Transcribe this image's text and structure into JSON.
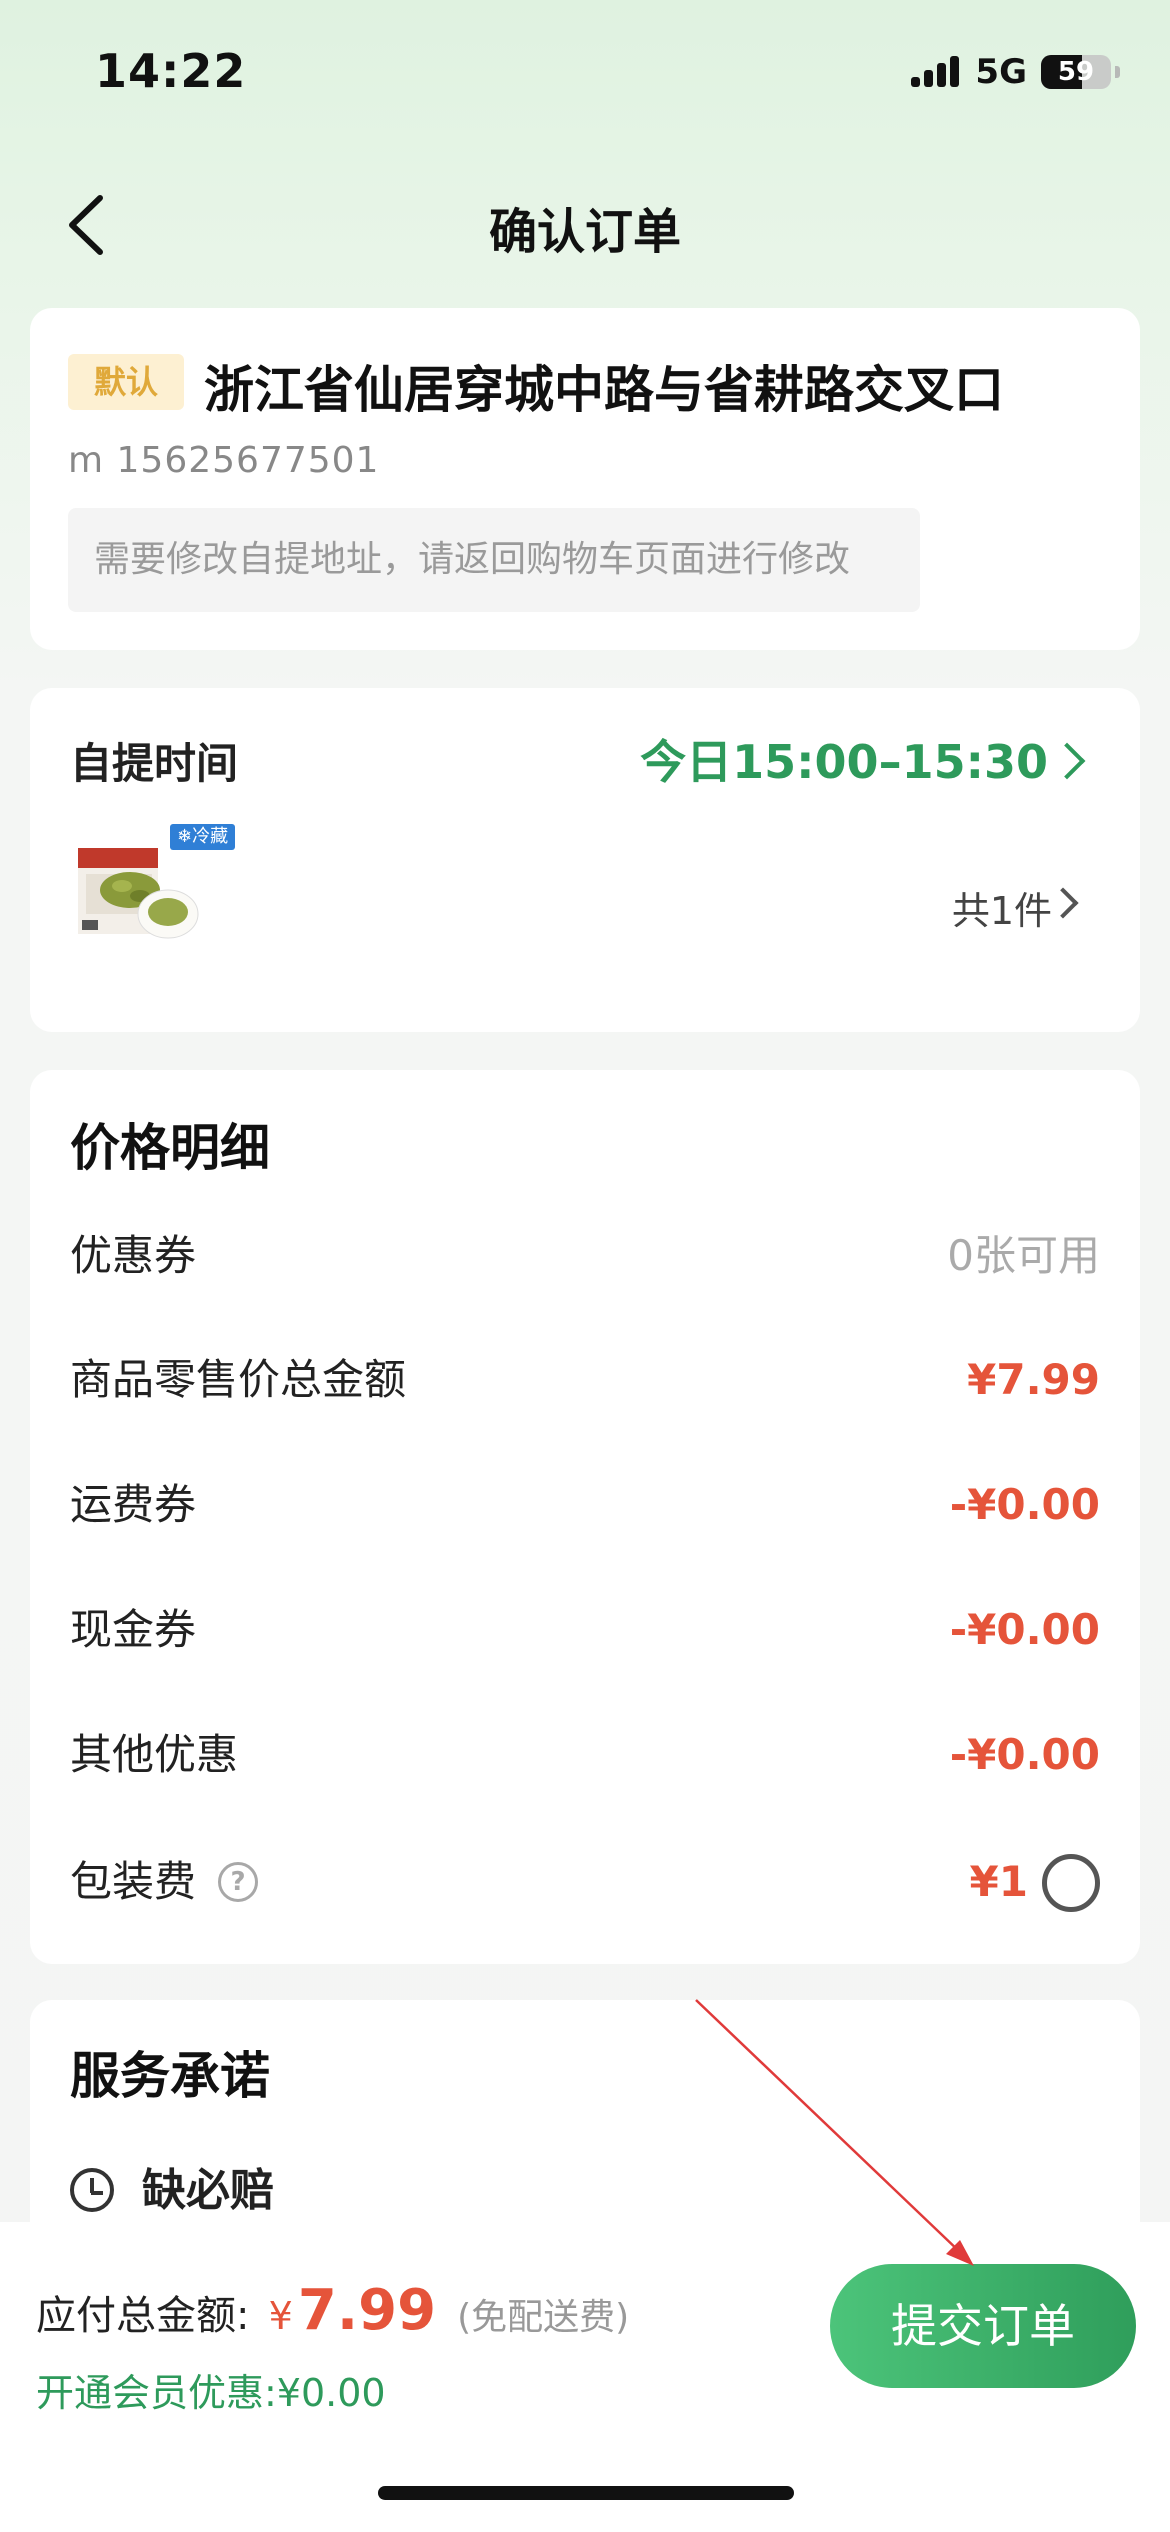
{
  "status_bar": {
    "time": "14:22",
    "network": "5G",
    "battery": "59"
  },
  "nav": {
    "title": "确认订单"
  },
  "address": {
    "badge": "默认",
    "text": "浙江省仙居穿城中路与省耕路交叉口",
    "phone": "m 15625677501",
    "note": "需要修改自提地址，请返回购物车页面进行修改"
  },
  "pickup": {
    "label": "自提时间",
    "time": "今日15:00–15:30",
    "product_tag": "冷藏",
    "count": "共1件"
  },
  "price": {
    "title": "价格明细",
    "rows": [
      {
        "label": "优惠券",
        "value": "0张可用"
      },
      {
        "label": "商品零售价总金额",
        "value": "¥7.99"
      },
      {
        "label": "运费券",
        "value": "-¥0.00"
      },
      {
        "label": "现金券",
        "value": "-¥0.00"
      },
      {
        "label": "其他优惠",
        "value": "-¥0.00"
      },
      {
        "label": "包装费",
        "value": "¥1"
      }
    ]
  },
  "service": {
    "title": "服务承诺",
    "item": "缺必赔"
  },
  "bottom": {
    "total_label": "应付总金额:",
    "currency": "¥",
    "total_amount": "7.99",
    "total_note": "(免配送费)",
    "member": "开通会员优惠:¥0.00",
    "submit": "提交订单"
  },
  "colors": {
    "accent_green": "#2e9a5b",
    "price_red": "#e5543a",
    "annotation_arrow": "#e03a3a"
  },
  "icons": [
    "back-icon",
    "chevron-right-icon",
    "help-icon",
    "radio-icon",
    "clock-icon",
    "signal-icon",
    "battery-icon"
  ]
}
